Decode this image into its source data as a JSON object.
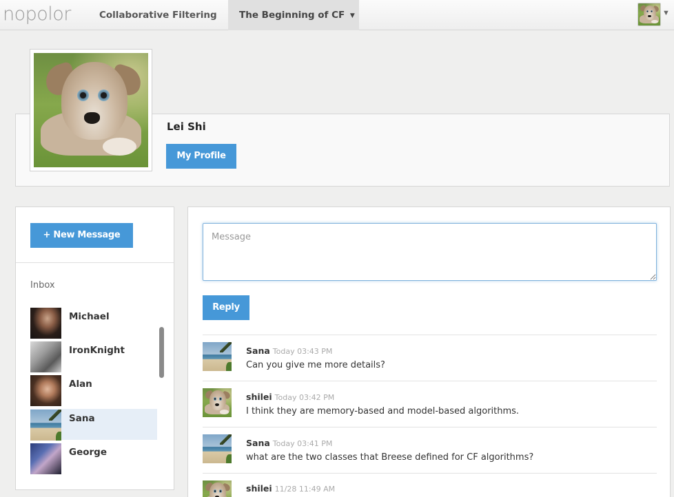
{
  "app": {
    "logo_text": "nopolor"
  },
  "nav": {
    "items": [
      {
        "label": "Collaborative Filtering"
      },
      {
        "label": "The Beginning of CF"
      }
    ]
  },
  "profile": {
    "name": "Lei Shi",
    "button_label": "My Profile"
  },
  "sidebar": {
    "new_message_label": "+ New Message",
    "inbox_label": "Inbox",
    "contacts": [
      {
        "name": "Michael"
      },
      {
        "name": "IronKnight"
      },
      {
        "name": "Alan"
      },
      {
        "name": "Sana",
        "selected": true
      },
      {
        "name": "George"
      }
    ]
  },
  "composer": {
    "placeholder": "Message",
    "reply_label": "Reply"
  },
  "messages": [
    {
      "author": "Sana",
      "time": "Today 03:43 PM",
      "text": "Can you give me more details?"
    },
    {
      "author": "shilei",
      "time": "Today 03:42 PM",
      "text": "I think they are memory-based and model-based algorithms."
    },
    {
      "author": "Sana",
      "time": "Today 03:41 PM",
      "text": "what are the two classes that Breese defined for CF algorithms?"
    },
    {
      "author": "shilei",
      "time": "11/28 11:49 AM",
      "text": ""
    }
  ],
  "colors": {
    "accent": "#4698d8",
    "selected_row": "#e6eef7",
    "background": "#efefee"
  },
  "icons": {
    "nav_caret": "caret-down-icon",
    "user_caret": "caret-down-icon"
  }
}
